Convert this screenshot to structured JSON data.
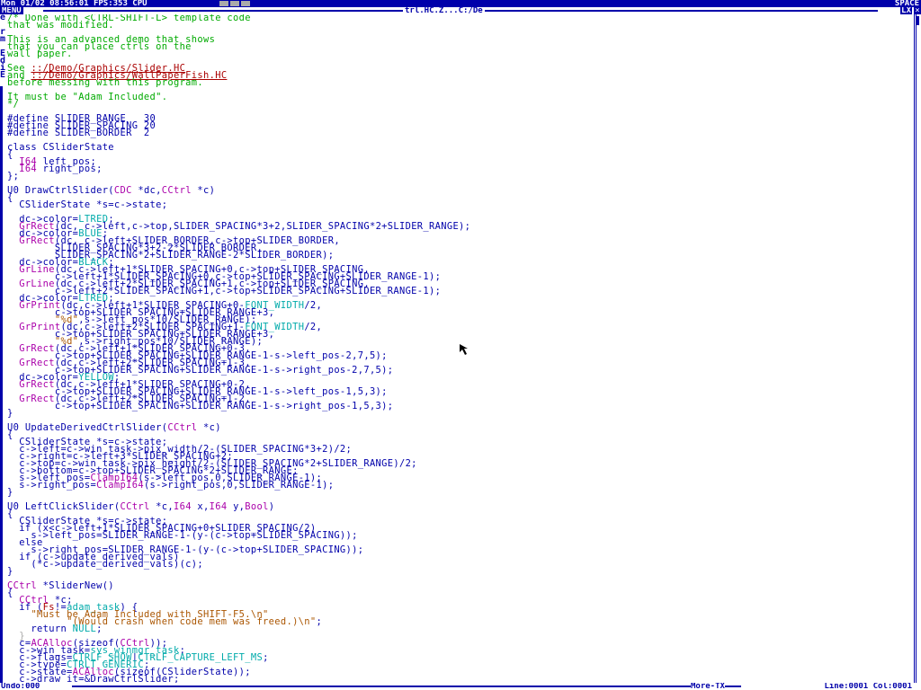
{
  "topbar": {
    "status": "Mon 01/02 08:56:01 FPS:353 CPU",
    "cpu_bar_count": 3,
    "space_label": "SPACE"
  },
  "titlebar": {
    "menu_label": "MENU",
    "window_title": "trl.HC.Z...C:/De",
    "lx_label": "LX",
    "close_symbol": "×"
  },
  "sidechars": [
    "e",
    "",
    "r",
    "m",
    "",
    "E",
    "d",
    "i",
    "E",
    ""
  ],
  "editor": {
    "lines": [
      [
        {
          "t": "/* Done with <CTRL-SHIFT-L> template code",
          "c": "comment"
        }
      ],
      [
        {
          "t": "that was modified.",
          "c": "comment"
        }
      ],
      [
        {
          "t": "",
          "c": "comment"
        }
      ],
      [
        {
          "t": "This is an advanced demo that shows",
          "c": "comment"
        }
      ],
      [
        {
          "t": "that you can place ctrls on the",
          "c": "comment"
        }
      ],
      [
        {
          "t": "wall paper.",
          "c": "comment"
        }
      ],
      [
        {
          "t": "",
          "c": "comment"
        }
      ],
      [
        {
          "t": "See ",
          "c": "comment"
        },
        {
          "t": "::/Demo/Graphics/Slider.HC",
          "c": "link"
        }
      ],
      [
        {
          "t": "and ",
          "c": "comment"
        },
        {
          "t": "::/Demo/Graphics/WallPaperFish.HC",
          "c": "link"
        }
      ],
      [
        {
          "t": "before messing with this program.",
          "c": "comment"
        }
      ],
      [
        {
          "t": "",
          "c": "comment"
        }
      ],
      [
        {
          "t": "It must be \"Adam Included\".",
          "c": "comment"
        }
      ],
      [
        {
          "t": "*/",
          "c": "comment"
        }
      ],
      [
        {
          "t": "",
          "c": "default"
        }
      ],
      [
        {
          "t": "#define SLIDER_RANGE   30",
          "c": "default"
        }
      ],
      [
        {
          "t": "#define SLIDER_SPACING 20",
          "c": "default"
        }
      ],
      [
        {
          "t": "#define SLIDER_BORDER  2",
          "c": "default"
        }
      ],
      [
        {
          "t": "",
          "c": "default"
        }
      ],
      [
        {
          "t": "class CSliderState",
          "c": "default"
        }
      ],
      [
        {
          "t": "{",
          "c": "default"
        }
      ],
      [
        {
          "t": "  ",
          "c": "default"
        },
        {
          "t": "I64",
          "c": "purple"
        },
        {
          "t": " left_pos;",
          "c": "default"
        }
      ],
      [
        {
          "t": "  ",
          "c": "default"
        },
        {
          "t": "I64",
          "c": "purple"
        },
        {
          "t": " right_pos;",
          "c": "default"
        }
      ],
      [
        {
          "t": "};",
          "c": "default"
        }
      ],
      [
        {
          "t": "",
          "c": "default"
        }
      ],
      [
        {
          "t": "U0 DrawCtrlSlider(",
          "c": "default"
        },
        {
          "t": "CDC",
          "c": "purple"
        },
        {
          "t": " *dc,",
          "c": "default"
        },
        {
          "t": "CCtrl",
          "c": "purple"
        },
        {
          "t": " *c)",
          "c": "default"
        }
      ],
      [
        {
          "t": "{",
          "c": "default"
        }
      ],
      [
        {
          "t": "  CSliderState *s=c->state;",
          "c": "default"
        }
      ],
      [
        {
          "t": "",
          "c": "default"
        }
      ],
      [
        {
          "t": "  dc->color=",
          "c": "default"
        },
        {
          "t": "LTRED",
          "c": "cyan"
        },
        {
          "t": ";",
          "c": "default"
        }
      ],
      [
        {
          "t": "  ",
          "c": "default"
        },
        {
          "t": "GrRect",
          "c": "purple"
        },
        {
          "t": "(dc, c->left,c->top,SLIDER_SPACING*3+2,SLIDER_SPACING*2+SLIDER_RANGE);",
          "c": "default"
        }
      ],
      [
        {
          "t": "  dc->color=",
          "c": "default"
        },
        {
          "t": "BLUE",
          "c": "cyan"
        },
        {
          "t": ";",
          "c": "default"
        }
      ],
      [
        {
          "t": "  ",
          "c": "default"
        },
        {
          "t": "GrRect",
          "c": "purple"
        },
        {
          "t": "(dc, c->left+SLIDER_BORDER,c->top+SLIDER_BORDER,",
          "c": "default"
        }
      ],
      [
        {
          "t": "        SLIDER_SPACING*3+2-2*SLIDER_BORDER,",
          "c": "default"
        }
      ],
      [
        {
          "t": "        SLIDER_SPACING*2+SLIDER_RANGE-2*SLIDER_BORDER);",
          "c": "default"
        }
      ],
      [
        {
          "t": "  dc->color=",
          "c": "default"
        },
        {
          "t": "BLACK",
          "c": "cyan"
        },
        {
          "t": ";",
          "c": "default"
        }
      ],
      [
        {
          "t": "  ",
          "c": "default"
        },
        {
          "t": "GrLine",
          "c": "purple"
        },
        {
          "t": "(dc,c->left+1*SLIDER_SPACING+0,c->top+SLIDER_SPACING,",
          "c": "default"
        }
      ],
      [
        {
          "t": "        c->left+1*SLIDER_SPACING+0,c->top+SLIDER_SPACING+SLIDER_RANGE-1);",
          "c": "default"
        }
      ],
      [
        {
          "t": "  ",
          "c": "default"
        },
        {
          "t": "GrLine",
          "c": "purple"
        },
        {
          "t": "(dc,c->left+2*SLIDER_SPACING+1,c->top+SLIDER_SPACING,",
          "c": "default"
        }
      ],
      [
        {
          "t": "        c->left+2*SLIDER_SPACING+1,c->top+SLIDER_SPACING+SLIDER_RANGE-1);",
          "c": "default"
        }
      ],
      [
        {
          "t": "  dc->color=",
          "c": "default"
        },
        {
          "t": "LTRED",
          "c": "cyan"
        },
        {
          "t": ";",
          "c": "default"
        }
      ],
      [
        {
          "t": "  ",
          "c": "default"
        },
        {
          "t": "GrPrint",
          "c": "purple"
        },
        {
          "t": "(dc,c->left+1*SLIDER_SPACING+0-",
          "c": "default"
        },
        {
          "t": "FONT_WIDTH",
          "c": "cyan"
        },
        {
          "t": "/2,",
          "c": "default"
        }
      ],
      [
        {
          "t": "        c->top+SLIDER_SPACING+SLIDER_RANGE+3,",
          "c": "default"
        }
      ],
      [
        {
          "t": "        ",
          "c": "default"
        },
        {
          "t": "\"%d\"",
          "c": "brown"
        },
        {
          "t": ",s->left_pos*10/SLIDER_RANGE);",
          "c": "default"
        }
      ],
      [
        {
          "t": "  ",
          "c": "default"
        },
        {
          "t": "GrPrint",
          "c": "purple"
        },
        {
          "t": "(dc,c->left+2*SLIDER_SPACING+1-",
          "c": "default"
        },
        {
          "t": "FONT_WIDTH",
          "c": "cyan"
        },
        {
          "t": "/2,",
          "c": "default"
        }
      ],
      [
        {
          "t": "        c->top+SLIDER_SPACING+SLIDER_RANGE+3,",
          "c": "default"
        }
      ],
      [
        {
          "t": "        ",
          "c": "default"
        },
        {
          "t": "\"%d\"",
          "c": "brown"
        },
        {
          "t": ",s->right_pos*10/SLIDER_RANGE);",
          "c": "default"
        }
      ],
      [
        {
          "t": "  ",
          "c": "default"
        },
        {
          "t": "GrRect",
          "c": "purple"
        },
        {
          "t": "(dc,c->left+1*SLIDER_SPACING+0-3,",
          "c": "default"
        }
      ],
      [
        {
          "t": "        c->top+SLIDER_SPACING+SLIDER_RANGE-1-s->left_pos-2,7,5);",
          "c": "default"
        }
      ],
      [
        {
          "t": "  ",
          "c": "default"
        },
        {
          "t": "GrRect",
          "c": "purple"
        },
        {
          "t": "(dc,c->left+2*SLIDER_SPACING+1-3,",
          "c": "default"
        }
      ],
      [
        {
          "t": "        c->top+SLIDER_SPACING+SLIDER_RANGE-1-s->right_pos-2,7,5);",
          "c": "default"
        }
      ],
      [
        {
          "t": "  dc->color=",
          "c": "default"
        },
        {
          "t": "YELLOW",
          "c": "cyan"
        },
        {
          "t": ";",
          "c": "default"
        }
      ],
      [
        {
          "t": "  ",
          "c": "default"
        },
        {
          "t": "GrRect",
          "c": "purple"
        },
        {
          "t": "(dc,c->left+1*SLIDER_SPACING+0-2,",
          "c": "default"
        }
      ],
      [
        {
          "t": "        c->top+SLIDER_SPACING+SLIDER_RANGE-1-s->left_pos-1,5,3);",
          "c": "default"
        }
      ],
      [
        {
          "t": "  ",
          "c": "default"
        },
        {
          "t": "GrRect",
          "c": "purple"
        },
        {
          "t": "(dc,c->left+2*SLIDER_SPACING+1-2,",
          "c": "default"
        }
      ],
      [
        {
          "t": "        c->top+SLIDER_SPACING+SLIDER_RANGE-1-s->right_pos-1,5,3);",
          "c": "default"
        }
      ],
      [
        {
          "t": "}",
          "c": "default"
        }
      ],
      [
        {
          "t": "",
          "c": "default"
        }
      ],
      [
        {
          "t": "U0 UpdateDerivedCtrlSlider(",
          "c": "default"
        },
        {
          "t": "CCtrl",
          "c": "purple"
        },
        {
          "t": " *c)",
          "c": "default"
        }
      ],
      [
        {
          "t": "{",
          "c": "default"
        }
      ],
      [
        {
          "t": "  CSliderState *s=c->state;",
          "c": "default"
        }
      ],
      [
        {
          "t": "  c->left=c->win_task->pix_width/2-(SLIDER_SPACING*3+2)/2;",
          "c": "default"
        }
      ],
      [
        {
          "t": "  c->right=c->left+3*SLIDER_SPACING+2;",
          "c": "default"
        }
      ],
      [
        {
          "t": "  c->top=c->win_task->pix_height/2-(SLIDER_SPACING*2+SLIDER_RANGE)/2;",
          "c": "default"
        }
      ],
      [
        {
          "t": "  c->bottom=c->top+SLIDER_SPACING*2+SLIDER_RANGE;",
          "c": "default"
        }
      ],
      [
        {
          "t": "  s->left_pos=",
          "c": "default"
        },
        {
          "t": "ClampI64",
          "c": "purple"
        },
        {
          "t": "(s->left_pos,0,SLIDER_RANGE-1);",
          "c": "default"
        }
      ],
      [
        {
          "t": "  s->right_pos=",
          "c": "default"
        },
        {
          "t": "ClampI64",
          "c": "purple"
        },
        {
          "t": "(s->right_pos,0,SLIDER_RANGE-1);",
          "c": "default"
        }
      ],
      [
        {
          "t": "}",
          "c": "default"
        }
      ],
      [
        {
          "t": "",
          "c": "default"
        }
      ],
      [
        {
          "t": "U0 LeftClickSlider(",
          "c": "default"
        },
        {
          "t": "CCtrl",
          "c": "purple"
        },
        {
          "t": " *c,",
          "c": "default"
        },
        {
          "t": "I64",
          "c": "purple"
        },
        {
          "t": " x,",
          "c": "default"
        },
        {
          "t": "I64",
          "c": "purple"
        },
        {
          "t": " y,",
          "c": "default"
        },
        {
          "t": "Bool",
          "c": "purple"
        },
        {
          "t": ")",
          "c": "default"
        }
      ],
      [
        {
          "t": "{",
          "c": "default"
        }
      ],
      [
        {
          "t": "  CSliderState *s=c->state;",
          "c": "default"
        }
      ],
      [
        {
          "t": "  if (x<c->left+1*SLIDER_SPACING+0+SLIDER_SPACING/2)",
          "c": "default"
        }
      ],
      [
        {
          "t": "    s->left_pos=SLIDER_RANGE-1-(y-(c->top+SLIDER_SPACING));",
          "c": "default"
        }
      ],
      [
        {
          "t": "  else",
          "c": "default"
        }
      ],
      [
        {
          "t": "    s->right_pos=SLIDER_RANGE-1-(y-(c->top+SLIDER_SPACING));",
          "c": "default"
        }
      ],
      [
        {
          "t": "  if (c->update_derived_vals)",
          "c": "default"
        }
      ],
      [
        {
          "t": "    (*c->update_derived_vals)(c);",
          "c": "default"
        }
      ],
      [
        {
          "t": "}",
          "c": "default"
        }
      ],
      [
        {
          "t": "",
          "c": "default"
        }
      ],
      [
        {
          "t": "CCtrl",
          "c": "purple"
        },
        {
          "t": " *SliderNew()",
          "c": "default"
        }
      ],
      [
        {
          "t": "{",
          "c": "default"
        }
      ],
      [
        {
          "t": "  ",
          "c": "default"
        },
        {
          "t": "CCtrl",
          "c": "purple"
        },
        {
          "t": " *c;",
          "c": "default"
        }
      ],
      [
        {
          "t": "  if (",
          "c": "default"
        },
        {
          "t": "Fs",
          "c": "red"
        },
        {
          "t": "!=",
          "c": "default"
        },
        {
          "t": "adam_task",
          "c": "cyan"
        },
        {
          "t": ") {",
          "c": "default"
        }
      ],
      [
        {
          "t": "    ",
          "c": "default"
        },
        {
          "t": "\"Must be Adam Included with SHIFT-F5.\\n\"",
          "c": "brown"
        }
      ],
      [
        {
          "t": "          ",
          "c": "default"
        },
        {
          "t": "\"(Would crash when code mem was freed.)\\n\"",
          "c": "brown"
        },
        {
          "t": ";",
          "c": "default"
        }
      ],
      [
        {
          "t": "    return ",
          "c": "default"
        },
        {
          "t": "NULL",
          "c": "cyan"
        },
        {
          "t": ";",
          "c": "default"
        }
      ],
      [
        {
          "t": "  }",
          "c": "gray"
        }
      ],
      [
        {
          "t": "  c=",
          "c": "default"
        },
        {
          "t": "ACAlloc",
          "c": "purple"
        },
        {
          "t": "(sizeof(",
          "c": "default"
        },
        {
          "t": "CCtrl",
          "c": "purple"
        },
        {
          "t": "));",
          "c": "default"
        }
      ],
      [
        {
          "t": "  c->win_task=",
          "c": "default"
        },
        {
          "t": "sys_winmgr_task",
          "c": "cyan"
        },
        {
          "t": ";",
          "c": "default"
        }
      ],
      [
        {
          "t": "  c->flags=",
          "c": "default"
        },
        {
          "t": "CTRLF_SHOW",
          "c": "cyan"
        },
        {
          "t": "|",
          "c": "default"
        },
        {
          "t": "CTRLF_CAPTURE_LEFT_MS",
          "c": "cyan"
        },
        {
          "t": ";",
          "c": "default"
        }
      ],
      [
        {
          "t": "  c->type=",
          "c": "default"
        },
        {
          "t": "CTRLT_GENERIC",
          "c": "cyan"
        },
        {
          "t": ";",
          "c": "default"
        }
      ],
      [
        {
          "t": "  c->state=",
          "c": "default"
        },
        {
          "t": "ACAlloc",
          "c": "purple"
        },
        {
          "t": "(sizeof(CSliderState));",
          "c": "default"
        }
      ],
      [
        {
          "t": "  c->draw_it=&DrawCtrlSlider;",
          "c": "default"
        }
      ]
    ]
  },
  "bottombar": {
    "undo_label": "Undo:000",
    "more_label": "More-TX",
    "line_col": "Line:0001 Col:0001"
  },
  "colors": {
    "blue": "#0000aa",
    "green": "#00aa00",
    "red": "#aa0000",
    "purple": "#aa00aa",
    "cyan": "#00aaaa",
    "brown": "#aa5500"
  }
}
